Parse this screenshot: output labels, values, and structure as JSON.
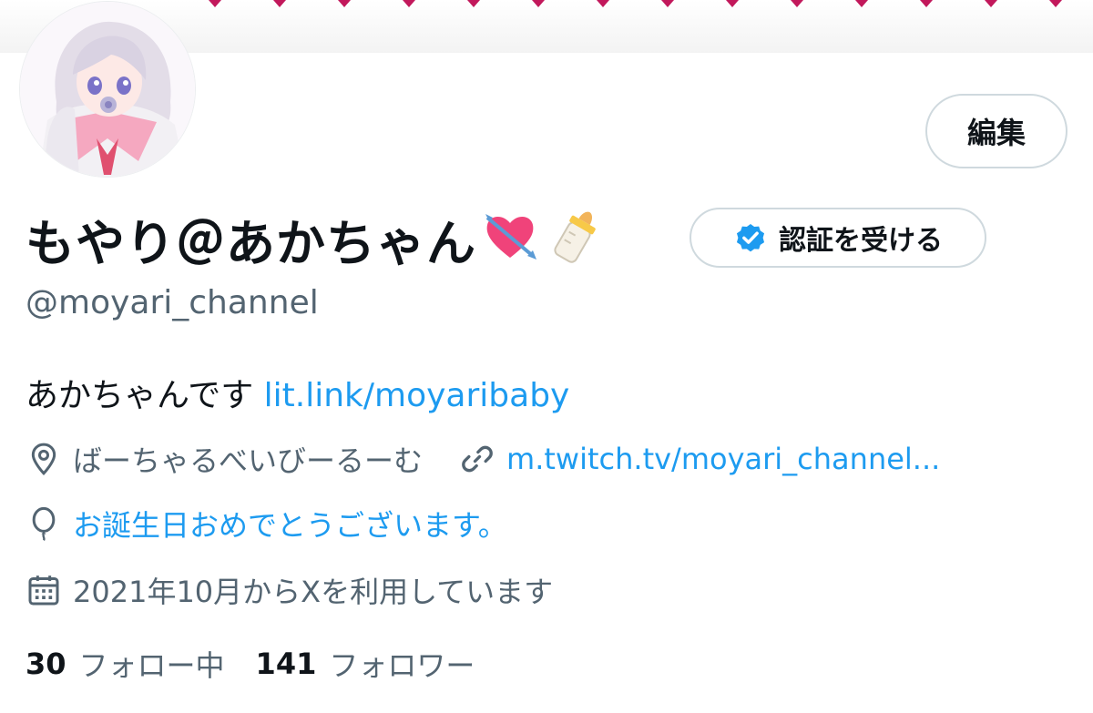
{
  "profile": {
    "display_name": "もやり＠あかちゃん",
    "name_emoji_1": "💘",
    "name_emoji_2": "🍼",
    "handle": "@moyari_channel",
    "bio_text": "あかちゃんです ",
    "bio_link": "lit.link/moyaribaby",
    "location": "ばーちゃるべいびーるーむ",
    "website": "m.twitch.tv/moyari_channel...",
    "birthday": "お誕生日おめでとうございます。",
    "joined": "2021年10月からXを利用しています"
  },
  "buttons": {
    "edit": "編集",
    "verify": "認証を受ける"
  },
  "stats": {
    "following_count": "30",
    "following_label": "フォロー中",
    "followers_count": "141",
    "followers_label": "フォロワー"
  },
  "colors": {
    "accent": "#1d9bf0",
    "secondary_text": "#536471",
    "primary_text": "#0f1419",
    "border": "#cfd9de",
    "banner_dot": "#c2185b"
  },
  "icons": {
    "location": "map-pin-icon",
    "website": "link-icon",
    "birthday": "balloon-icon",
    "joined": "calendar-icon",
    "verified": "verified-badge-icon"
  }
}
